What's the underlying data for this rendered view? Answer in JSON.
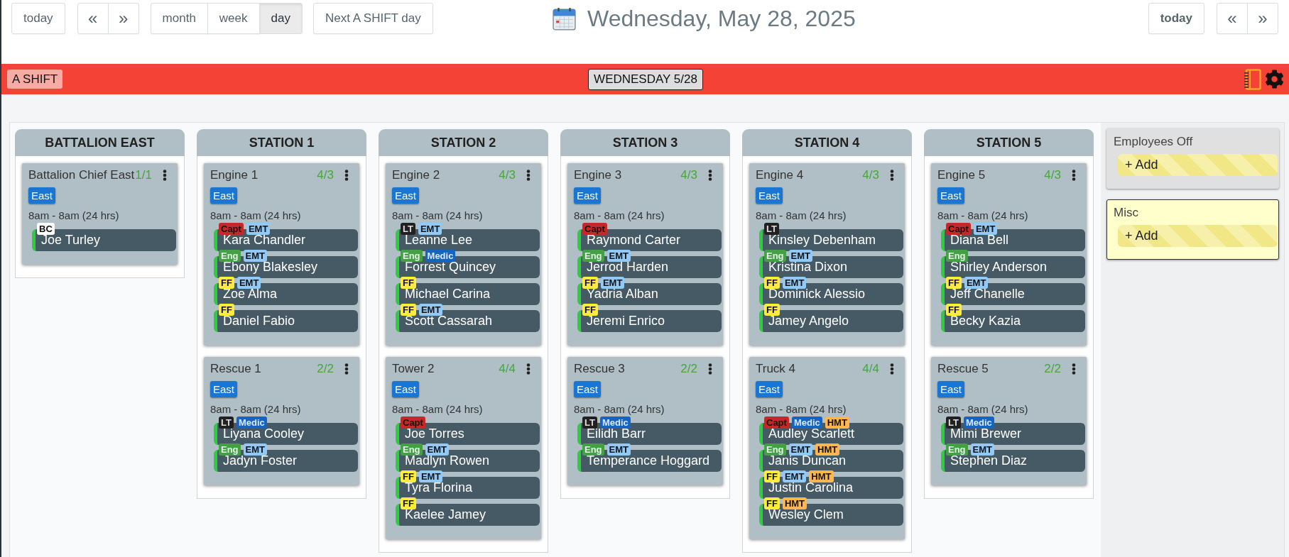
{
  "toolbar": {
    "today_button": "today",
    "nav_buttons": [
      "«",
      "»"
    ],
    "views": [
      {
        "label": "month",
        "selected": false
      },
      {
        "label": "week",
        "selected": false
      },
      {
        "label": "day",
        "selected": true
      }
    ],
    "next_shift_button": "Next A SHIFT day",
    "title": "Wednesday, May 28, 2025",
    "right_today_button": "today",
    "right_nav_buttons": [
      "«",
      "»"
    ]
  },
  "shift_bar": {
    "shift_label": "A SHIFT",
    "date_button": "WEDNESDAY 5/28"
  },
  "columns": [
    {
      "title": "BATTALION EAST",
      "units": [
        {
          "name": "Battalion Chief East",
          "count": "1/1",
          "zone": "East",
          "hours": "8am - 8am (24 hrs)",
          "members": [
            {
              "name": "Joe Turley",
              "tags": [
                {
                  "label": "BC",
                  "color": "#ffffff"
                }
              ]
            }
          ]
        }
      ]
    },
    {
      "title": "STATION 1",
      "units": [
        {
          "name": "Engine 1",
          "count": "4/3",
          "zone": "East",
          "hours": "8am - 8am (24 hrs)",
          "members": [
            {
              "name": "Kara Chandler",
              "tags": [
                {
                  "label": "Capt",
                  "color": "#c62828"
                },
                {
                  "label": "EMT",
                  "color": "#90caf9"
                }
              ]
            },
            {
              "name": "Ebony Blakesley",
              "tags": [
                {
                  "label": "Eng",
                  "color": "#43a047"
                },
                {
                  "label": "EMT",
                  "color": "#90caf9"
                }
              ]
            },
            {
              "name": "Zoe Alma",
              "tags": [
                {
                  "label": "FF",
                  "color": "#ffeb3b"
                },
                {
                  "label": "EMT",
                  "color": "#90caf9"
                }
              ]
            },
            {
              "name": "Daniel Fabio",
              "tags": [
                {
                  "label": "FF",
                  "color": "#ffeb3b"
                }
              ]
            }
          ]
        },
        {
          "name": "Rescue 1",
          "count": "2/2",
          "zone": "East",
          "hours": "8am - 8am (24 hrs)",
          "members": [
            {
              "name": "Liyana Cooley",
              "tags": [
                {
                  "label": "LT",
                  "color": "#212121"
                },
                {
                  "label": "Medic",
                  "color": "#1565c0"
                }
              ]
            },
            {
              "name": "Jadyn Foster",
              "tags": [
                {
                  "label": "Eng",
                  "color": "#43a047"
                },
                {
                  "label": "EMT",
                  "color": "#90caf9"
                }
              ]
            }
          ]
        }
      ]
    },
    {
      "title": "STATION 2",
      "units": [
        {
          "name": "Engine 2",
          "count": "4/3",
          "zone": "East",
          "hours": "8am - 8am (24 hrs)",
          "members": [
            {
              "name": "Leanne Lee",
              "tags": [
                {
                  "label": "LT",
                  "color": "#212121"
                },
                {
                  "label": "EMT",
                  "color": "#90caf9"
                }
              ]
            },
            {
              "name": "Forrest Quincey",
              "tags": [
                {
                  "label": "Eng",
                  "color": "#43a047"
                },
                {
                  "label": "Medic",
                  "color": "#1565c0"
                }
              ]
            },
            {
              "name": "Michael Carina",
              "tags": [
                {
                  "label": "FF",
                  "color": "#ffeb3b"
                }
              ]
            },
            {
              "name": "Scott Cassarah",
              "tags": [
                {
                  "label": "FF",
                  "color": "#ffeb3b"
                },
                {
                  "label": "EMT",
                  "color": "#90caf9"
                }
              ]
            }
          ]
        },
        {
          "name": "Tower 2",
          "count": "4/4",
          "zone": "East",
          "hours": "8am - 8am (24 hrs)",
          "members": [
            {
              "name": "Joe Torres",
              "tags": [
                {
                  "label": "Capt",
                  "color": "#c62828"
                }
              ]
            },
            {
              "name": "Madlyn Rowen",
              "tags": [
                {
                  "label": "Eng",
                  "color": "#43a047"
                },
                {
                  "label": "EMT",
                  "color": "#90caf9"
                }
              ]
            },
            {
              "name": "Tyra Florina",
              "tags": [
                {
                  "label": "FF",
                  "color": "#ffeb3b"
                },
                {
                  "label": "EMT",
                  "color": "#90caf9"
                }
              ]
            },
            {
              "name": "Kaelee Jamey",
              "tags": [
                {
                  "label": "FF",
                  "color": "#ffeb3b"
                }
              ]
            }
          ]
        }
      ]
    },
    {
      "title": "STATION 3",
      "units": [
        {
          "name": "Engine 3",
          "count": "4/3",
          "zone": "East",
          "hours": "8am - 8am (24 hrs)",
          "members": [
            {
              "name": "Raymond Carter",
              "tags": [
                {
                  "label": "Capt",
                  "color": "#c62828"
                }
              ]
            },
            {
              "name": "Jerrod Harden",
              "tags": [
                {
                  "label": "Eng",
                  "color": "#43a047"
                },
                {
                  "label": "EMT",
                  "color": "#90caf9"
                }
              ]
            },
            {
              "name": "Yadria Alban",
              "tags": [
                {
                  "label": "FF",
                  "color": "#ffeb3b"
                },
                {
                  "label": "EMT",
                  "color": "#90caf9"
                }
              ]
            },
            {
              "name": "Jeremi Enrico",
              "tags": [
                {
                  "label": "FF",
                  "color": "#ffeb3b"
                }
              ]
            }
          ]
        },
        {
          "name": "Rescue 3",
          "count": "2/2",
          "zone": "East",
          "hours": "8am - 8am (24 hrs)",
          "members": [
            {
              "name": "Eilidh Barr",
              "tags": [
                {
                  "label": "LT",
                  "color": "#212121"
                },
                {
                  "label": "Medic",
                  "color": "#1565c0"
                }
              ]
            },
            {
              "name": "Temperance Hoggard",
              "tags": [
                {
                  "label": "Eng",
                  "color": "#43a047"
                },
                {
                  "label": "EMT",
                  "color": "#90caf9"
                }
              ]
            }
          ]
        }
      ]
    },
    {
      "title": "STATION 4",
      "units": [
        {
          "name": "Engine 4",
          "count": "4/3",
          "zone": "East",
          "hours": "8am - 8am (24 hrs)",
          "members": [
            {
              "name": "Kinsley Debenham",
              "tags": [
                {
                  "label": "LT",
                  "color": "#212121"
                }
              ]
            },
            {
              "name": "Kristina Dixon",
              "tags": [
                {
                  "label": "Eng",
                  "color": "#43a047"
                },
                {
                  "label": "EMT",
                  "color": "#90caf9"
                }
              ]
            },
            {
              "name": "Dominick Alessio",
              "tags": [
                {
                  "label": "FF",
                  "color": "#ffeb3b"
                },
                {
                  "label": "EMT",
                  "color": "#90caf9"
                }
              ]
            },
            {
              "name": "Jamey Angelo",
              "tags": [
                {
                  "label": "FF",
                  "color": "#ffeb3b"
                }
              ]
            }
          ]
        },
        {
          "name": "Truck 4",
          "count": "4/4",
          "zone": "East",
          "hours": "8am - 8am (24 hrs)",
          "members": [
            {
              "name": "Audley Scarlett",
              "tags": [
                {
                  "label": "Capt",
                  "color": "#c62828"
                },
                {
                  "label": "Medic",
                  "color": "#1565c0"
                },
                {
                  "label": "HMT",
                  "color": "#ffb74d"
                }
              ]
            },
            {
              "name": "Janis Duncan",
              "tags": [
                {
                  "label": "Eng",
                  "color": "#43a047"
                },
                {
                  "label": "EMT",
                  "color": "#90caf9"
                },
                {
                  "label": "HMT",
                  "color": "#ffb74d"
                }
              ]
            },
            {
              "name": "Justin Carolina",
              "tags": [
                {
                  "label": "FF",
                  "color": "#ffeb3b"
                },
                {
                  "label": "EMT",
                  "color": "#90caf9"
                },
                {
                  "label": "HMT",
                  "color": "#ffb74d"
                }
              ]
            },
            {
              "name": "Wesley Clem",
              "tags": [
                {
                  "label": "FF",
                  "color": "#ffeb3b"
                },
                {
                  "label": "HMT",
                  "color": "#ffb74d"
                }
              ]
            }
          ]
        }
      ]
    },
    {
      "title": "STATION 5",
      "units": [
        {
          "name": "Engine 5",
          "count": "4/3",
          "zone": "East",
          "hours": "8am - 8am (24 hrs)",
          "members": [
            {
              "name": "Diana Bell",
              "tags": [
                {
                  "label": "Capt",
                  "color": "#c62828"
                },
                {
                  "label": "EMT",
                  "color": "#90caf9"
                }
              ]
            },
            {
              "name": "Shirley Anderson",
              "tags": [
                {
                  "label": "Eng",
                  "color": "#43a047"
                }
              ]
            },
            {
              "name": "Jeff Chanelle",
              "tags": [
                {
                  "label": "FF",
                  "color": "#ffeb3b"
                },
                {
                  "label": "EMT",
                  "color": "#90caf9"
                }
              ]
            },
            {
              "name": "Becky Kazia",
              "tags": [
                {
                  "label": "FF",
                  "color": "#ffeb3b"
                }
              ]
            }
          ]
        },
        {
          "name": "Rescue 5",
          "count": "2/2",
          "zone": "East",
          "hours": "8am - 8am (24 hrs)",
          "members": [
            {
              "name": "Mimi Brewer",
              "tags": [
                {
                  "label": "LT",
                  "color": "#212121"
                },
                {
                  "label": "Medic",
                  "color": "#1565c0"
                }
              ]
            },
            {
              "name": "Stephen Diaz",
              "tags": [
                {
                  "label": "Eng",
                  "color": "#43a047"
                },
                {
                  "label": "EMT",
                  "color": "#90caf9"
                }
              ]
            }
          ]
        }
      ]
    }
  ],
  "side_panels": [
    {
      "title": "Employees Off",
      "kind": "standard",
      "add_button": "+ Add"
    },
    {
      "title": "Misc",
      "kind": "note",
      "add_button": "+ Add"
    }
  ]
}
